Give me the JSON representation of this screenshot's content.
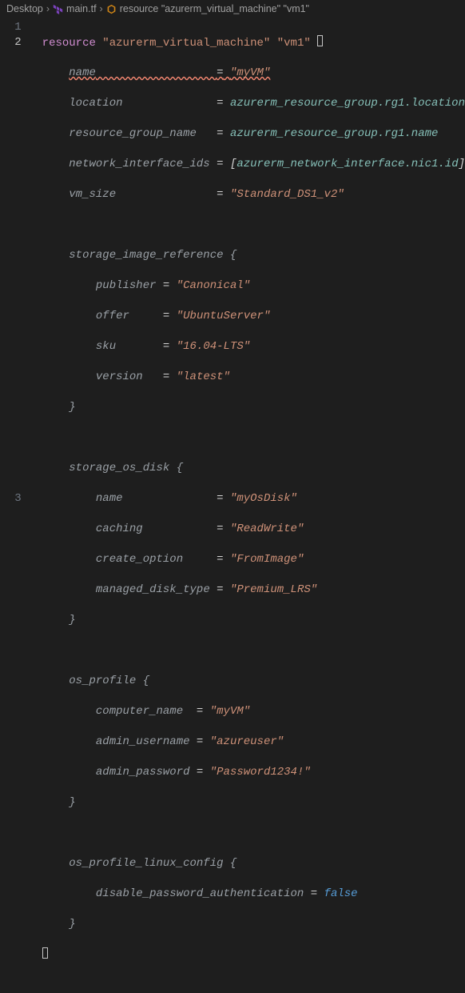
{
  "breadcrumb": {
    "parts": [
      "Desktop",
      "main.tf",
      "resource \"azurerm_virtual_machine\" \"vm1\""
    ]
  },
  "lineNumbers": [
    "1",
    "2",
    "3"
  ],
  "activeLine": "2",
  "code": {
    "l1": {
      "kw": "resource",
      "t1": "\"azurerm_virtual_machine\"",
      "t2": "\"vm1\"",
      "brace": "{"
    },
    "l2": {
      "name": "name",
      "eq": "=",
      "val": "\"myVM\""
    },
    "l3": {
      "k": "location",
      "eq": "=",
      "v": "azurerm_resource_group.rg1.location"
    },
    "l4": {
      "k": "resource_group_name",
      "eq": "=",
      "v": "azurerm_resource_group.rg1.name"
    },
    "l5": {
      "k": "network_interface_ids",
      "eq": "=",
      "lb": "[",
      "v": "azurerm_network_interface.nic1.id",
      "rb": "]"
    },
    "l6": {
      "k": "vm_size",
      "eq": "=",
      "v": "\"Standard_DS1_v2\""
    },
    "sir": {
      "head": "storage_image_reference {",
      "pub_k": "publisher",
      "pub_v": "\"Canonical\"",
      "off_k": "offer",
      "off_v": "\"UbuntuServer\"",
      "sku_k": "sku",
      "sku_v": "\"16.04-LTS\"",
      "ver_k": "version",
      "ver_v": "\"latest\"",
      "close": "}"
    },
    "sod": {
      "head": "storage_os_disk {",
      "n_k": "name",
      "n_v": "\"myOsDisk\"",
      "c_k": "caching",
      "c_v": "\"ReadWrite\"",
      "co_k": "create_option",
      "co_v": "\"FromImage\"",
      "mdt_k": "managed_disk_type",
      "mdt_v": "\"Premium_LRS\"",
      "close": "}"
    },
    "osp": {
      "head": "os_profile {",
      "cn_k": "computer_name",
      "cn_v": "\"myVM\"",
      "au_k": "admin_username",
      "au_v": "\"azureuser\"",
      "ap_k": "admin_password",
      "ap_v": "\"Password1234!\"",
      "close": "}"
    },
    "oplc": {
      "head": "os_profile_linux_config {",
      "dpa_k": "disable_password_authentication",
      "dpa_eq": "=",
      "dpa_v": "false",
      "close": "}"
    },
    "end": "}"
  }
}
